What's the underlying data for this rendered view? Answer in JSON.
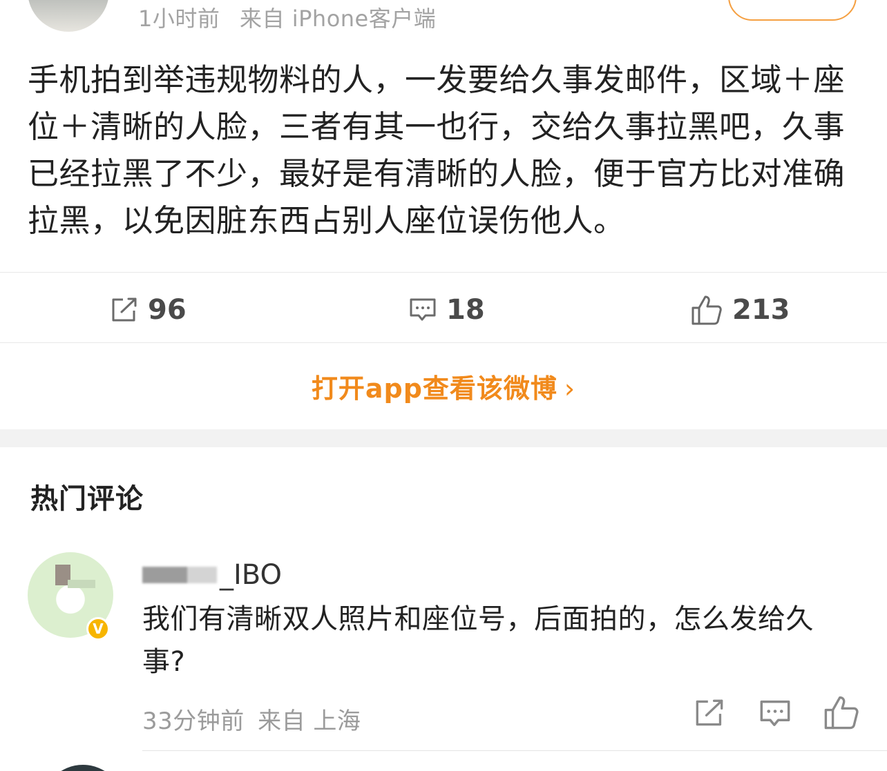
{
  "post": {
    "time": "1小时前",
    "source": "来自 iPhone客户端",
    "text": "手机拍到举违规物料的人，一发要给久事发邮件，区域＋座位＋清晰的人脸，三者有其一也行，交给久事拉黑吧，久事已经拉黑了不少，最好是有清晰的人脸，便于官方比对准确拉黑，以免因脏东西占别人座位误伤他人。"
  },
  "actions": {
    "repost": {
      "icon": "repost-icon",
      "count": "96"
    },
    "comment": {
      "icon": "comment-icon",
      "count": "18"
    },
    "like": {
      "icon": "thumbs-up-icon",
      "count": "213"
    }
  },
  "open_app": {
    "label": "打开app查看该微博",
    "chevron": "›"
  },
  "hot_comments": {
    "title": "热门评论",
    "items": [
      {
        "username_visible": "_IBO",
        "verified_badge": "V",
        "text": "我们有清晰双人照片和座位号，后面拍的，怎么发给久事?",
        "time": "33分钟前",
        "source": "来自 上海"
      }
    ]
  },
  "colors": {
    "accent": "#f18a1c",
    "follow_border": "#f5a042",
    "meta_text": "#a3a3a3",
    "badge": "#f7b500"
  }
}
